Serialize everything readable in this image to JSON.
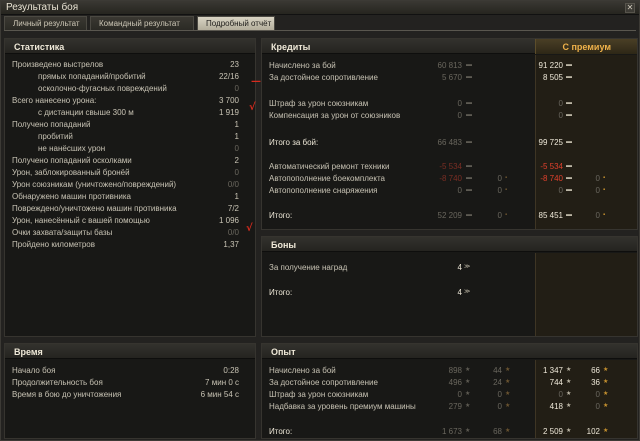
{
  "window": {
    "title": "Результаты боя",
    "close_label": "✕"
  },
  "tabs": [
    {
      "label": "Личный результат",
      "active": false
    },
    {
      "label": "Командный результат",
      "active": false
    },
    {
      "label": "Подробный отчёт",
      "active": true
    }
  ],
  "stats": {
    "title": "Статистика",
    "rows": [
      {
        "label": "Произведено выстрелов",
        "value": "23"
      },
      {
        "label": "прямых попаданий/пробитий",
        "value": "22/16"
      },
      {
        "label": "осколочно-фугасных повреждений",
        "value": "0"
      },
      {
        "label": "Всего нанесено урона:",
        "value": "3 700"
      },
      {
        "label": "с дистанции свыше 300 м",
        "value": "1 919"
      },
      {
        "label": "Получено попаданий",
        "value": "1"
      },
      {
        "label": "пробитий",
        "value": "1"
      },
      {
        "label": "не нанёсших урон",
        "value": "0"
      },
      {
        "label": "Получено попаданий осколками",
        "value": "2"
      },
      {
        "label": "Урон, заблокированный бронёй",
        "value": "0"
      },
      {
        "label": "Урон союзникам (уничтожено/повреждений)",
        "value": "0/0"
      },
      {
        "label": "Обнаружено машин противника",
        "value": "1"
      },
      {
        "label": "Повреждено/уничтожено машин противника",
        "value": "7/2"
      },
      {
        "label": "Урон, нанесённый с вашей помощью",
        "value": "1 096"
      },
      {
        "label": "Очки захвата/защиты базы",
        "value": "0/0"
      },
      {
        "label": "Пройдено километров",
        "value": "1,37"
      }
    ]
  },
  "time": {
    "title": "Время",
    "rows": [
      {
        "label": "Начало боя",
        "value": "0:28"
      },
      {
        "label": "Продолжительность боя",
        "value": "7 мин 0 с"
      },
      {
        "label": "Время в бою до уничтожения",
        "value": "6 мин 54 с"
      }
    ]
  },
  "credits": {
    "title": "Кредиты",
    "premium_header": "С премиум",
    "rows": [
      {
        "label": "Начислено за бой",
        "base": "60 813",
        "prem": "91 220",
        "gold": ""
      },
      {
        "label": "За достойное сопротивление",
        "base": "5 670",
        "prem": "8 505",
        "gold": ""
      },
      {
        "label": "Штраф за урон союзникам",
        "base": "0",
        "prem": "0",
        "gold": ""
      },
      {
        "label": "Компенсация за урон от союзников",
        "base": "0",
        "prem": "0",
        "gold": ""
      },
      {
        "label": "Итого за бой:",
        "base": "66 483",
        "prem": "99 725",
        "gold": ""
      },
      {
        "label": "Автоматический ремонт техники",
        "base": "-5 534",
        "prem": "-5 534",
        "gold": ""
      },
      {
        "label": "Автопополнение боекомплекта",
        "base": "-8 740",
        "prem": "-8 740",
        "gold": "0",
        "gold_base": "0"
      },
      {
        "label": "Автопополнение снаряжения",
        "base": "0",
        "prem": "0",
        "gold": "0",
        "gold_base": "0"
      },
      {
        "label": "Итого:",
        "base": "52 209",
        "prem": "85 451",
        "gold": "0",
        "gold_base": "0"
      }
    ]
  },
  "bonds": {
    "title": "Боны",
    "rows": [
      {
        "label": "За получение наград",
        "value": "4"
      },
      {
        "label": "Итого:",
        "value": "4"
      }
    ]
  },
  "experience": {
    "title": "Опыт",
    "rows": [
      {
        "label": "Начислено за бой",
        "base": "898",
        "base_free": "44",
        "prem": "1 347",
        "prem_free": "66"
      },
      {
        "label": "За достойное сопротивление",
        "base": "496",
        "base_free": "24",
        "prem": "744",
        "prem_free": "36"
      },
      {
        "label": "Штраф за урон союзникам",
        "base": "0",
        "base_free": "0",
        "prem": "0",
        "prem_free": "0"
      },
      {
        "label": "Надбавка за уровень премиум машины",
        "base": "279",
        "base_free": "0",
        "prem": "418",
        "prem_free": "0"
      },
      {
        "label": "Итого:",
        "base": "1 673",
        "base_free": "68",
        "prem": "2 509",
        "prem_free": "102"
      }
    ]
  },
  "icons": {
    "credit": "credit-icon",
    "bond": "bond-icon",
    "xp": "xp-star-icon",
    "free_xp": "free-xp-icon"
  },
  "colors": {
    "premium_header": "#f0b24a",
    "negative": "#e0402c",
    "annotation": "#d72b1e"
  }
}
